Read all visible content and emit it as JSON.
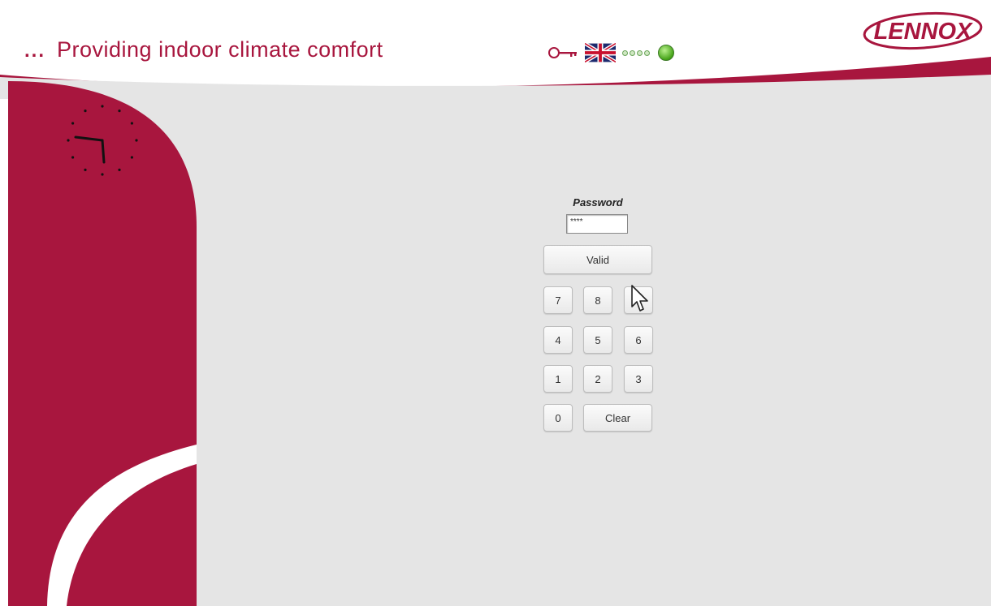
{
  "header": {
    "dots": "...",
    "tagline": "Providing indoor climate comfort",
    "logo_text": "LENNOX",
    "icons": [
      "key-icon",
      "uk-flag-icon",
      "status-led-icon",
      "connection-led-icon"
    ],
    "colors": {
      "brand": "#a8163e",
      "led": "#45a318",
      "background": "#e5e5e5"
    }
  },
  "login": {
    "password_label": "Password",
    "password_value": "****",
    "valid_label": "Valid",
    "keys_row1": [
      "7",
      "8",
      ""
    ],
    "keys_row2": [
      "4",
      "5",
      "6"
    ],
    "keys_row3": [
      "1",
      "2",
      "3"
    ],
    "key_zero": "0",
    "clear_label": "Clear"
  }
}
